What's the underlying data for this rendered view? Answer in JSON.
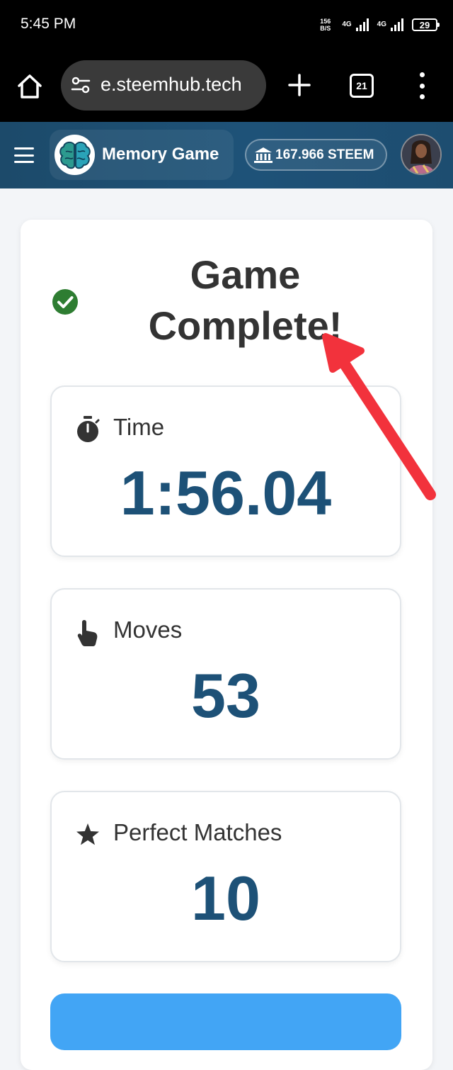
{
  "status_bar": {
    "time": "5:45 PM",
    "speed_value": "156",
    "speed_unit": "B/S",
    "network_1": "4G",
    "network_2": "4G",
    "battery": "29"
  },
  "browser": {
    "url": "e.steemhub.tech",
    "tab_count": "21",
    "icons": [
      "home-icon",
      "site-settings-icon",
      "plus-icon",
      "tabs-icon",
      "more-vert-icon"
    ]
  },
  "header": {
    "title": "Memory Game",
    "balance": "167.966 STEEM",
    "icons": [
      "hamburger-icon",
      "brain-logo",
      "bank-icon",
      "avatar"
    ]
  },
  "result": {
    "title": "Game Complete!",
    "stats": [
      {
        "label": "Time",
        "value": "1:56.04",
        "icon": "stopwatch-icon"
      },
      {
        "label": "Moves",
        "value": "53",
        "icon": "pointer-hand-icon"
      },
      {
        "label": "Perfect Matches",
        "value": "10",
        "icon": "star-icon"
      }
    ]
  },
  "colors": {
    "header_bg": "#1e5278",
    "stat_value": "#1d5177",
    "success": "#2e7d32",
    "button": "#42a5f5",
    "annotation_arrow": "#f2323c"
  }
}
